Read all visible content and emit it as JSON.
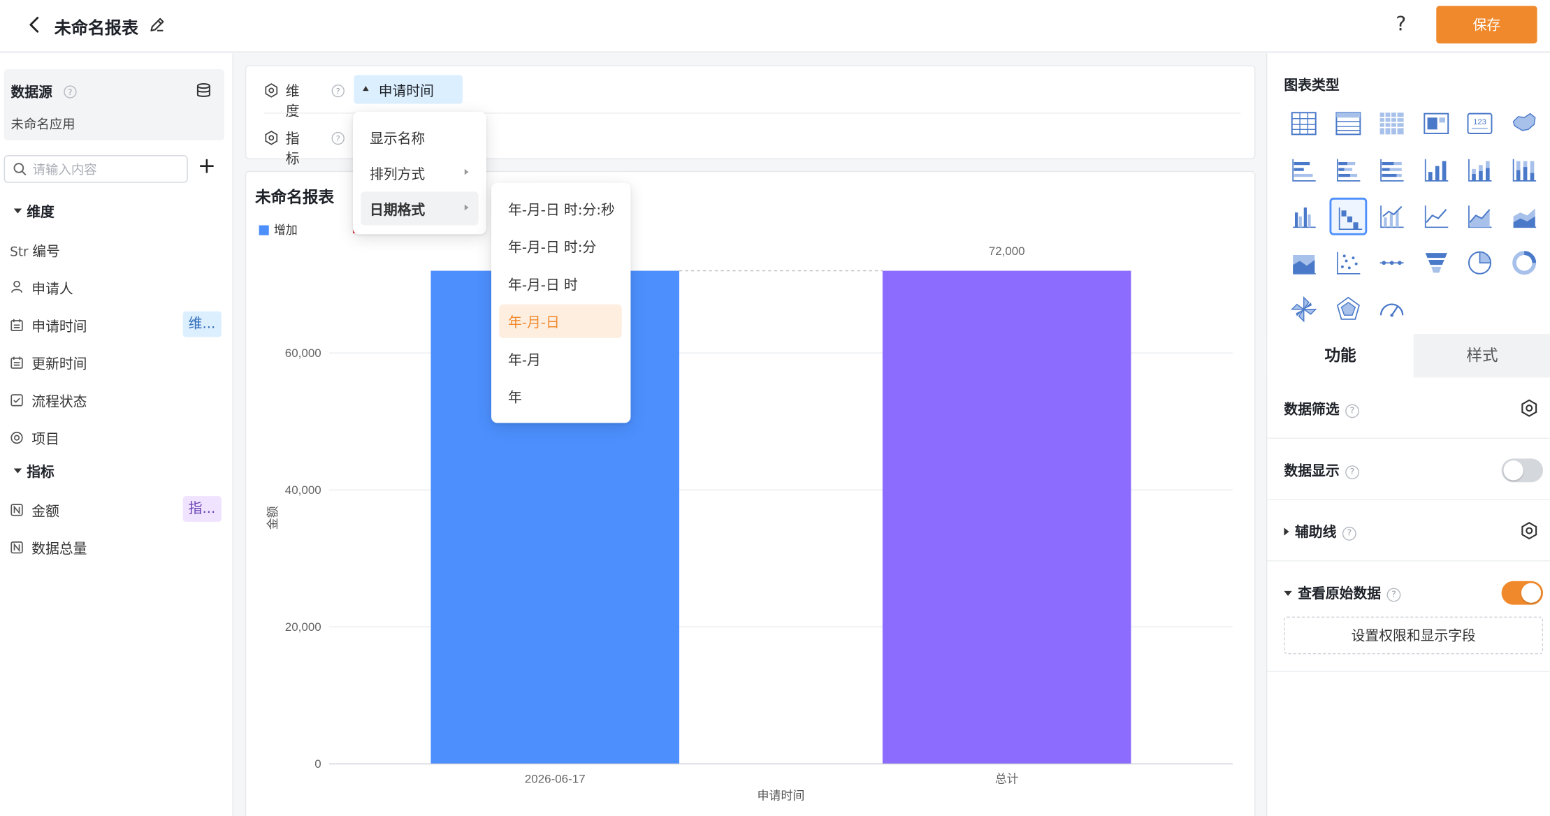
{
  "header": {
    "title": "未命名报表",
    "help": "?",
    "save_label": "保存"
  },
  "datasource": {
    "title": "数据源",
    "app_name": "未命名应用",
    "search_placeholder": "请输入内容",
    "add": "+"
  },
  "dimensions": {
    "label": "维度",
    "items": [
      {
        "icon": "Str",
        "label": "编号"
      },
      {
        "icon": "person-icon",
        "label": "申请人"
      },
      {
        "icon": "calendar-icon",
        "label": "申请时间",
        "tag": "维..."
      },
      {
        "icon": "calendar-icon",
        "label": "更新时间"
      },
      {
        "icon": "checkbox-icon",
        "label": "流程状态"
      },
      {
        "icon": "radio-icon",
        "label": "项目"
      }
    ]
  },
  "indicators": {
    "label": "指标",
    "items": [
      {
        "icon": "number-icon",
        "label": "金额",
        "tag": "指..."
      },
      {
        "icon": "number-icon",
        "label": "数据总量"
      }
    ]
  },
  "config": {
    "dimension_label": "维度",
    "indicator_label": "指标",
    "dimension_chip": "申请时间"
  },
  "dropdown": {
    "items": [
      "显示名称",
      "排列方式",
      "日期格式"
    ],
    "active": "日期格式"
  },
  "date_format_menu": {
    "items": [
      "年-月-日 时:分:秒",
      "年-月-日 时:分",
      "年-月-日 时",
      "年-月-日",
      "年-月",
      "年"
    ],
    "selected": "年-月-日"
  },
  "chart_card": {
    "title": "未命名报表",
    "legend_increase": "增加"
  },
  "chart_data": {
    "type": "bar",
    "subtype": "waterfall",
    "categories": [
      "2026-06-17",
      "总计"
    ],
    "values": [
      72000,
      72000
    ],
    "colors": [
      "#4c8ffd",
      "#8c6bff"
    ],
    "data_labels": [
      "",
      "72,000"
    ],
    "xlabel": "申请时间",
    "ylabel": "金额",
    "ylim": [
      0,
      72000
    ],
    "yticks": [
      0,
      20000,
      40000,
      60000
    ],
    "ytick_labels": [
      "0",
      "20,000",
      "40,000",
      "60,000"
    ],
    "grid": true,
    "legend": "top-left"
  },
  "right_panel": {
    "chart_type_title": "图表类型",
    "chart_types": [
      "table-icon",
      "list-table-icon",
      "pivot-table-icon",
      "card-icon",
      "number-card-icon",
      "map-icon",
      "bar-horizontal-icon",
      "stacked-bar-horizontal-icon",
      "percent-bar-horizontal-icon",
      "column-icon",
      "stacked-column-icon",
      "percent-column-icon",
      "grouped-column-icon",
      "waterfall-icon",
      "column-line-icon",
      "line-icon",
      "area-icon",
      "stacked-area-icon",
      "percent-area-icon",
      "scatter-icon",
      "dot-line-icon",
      "funnel-icon",
      "pie-icon",
      "donut-icon",
      "rose-icon",
      "radar-icon",
      "gauge-icon"
    ],
    "selected_chart_type": "waterfall-icon",
    "tabs": [
      "功能",
      "样式"
    ],
    "rows": {
      "data_filter": "数据筛选",
      "data_display": "数据显示",
      "aux_line": "辅助线",
      "raw_data": "查看原始数据",
      "perm_button": "设置权限和显示字段"
    },
    "help": "?",
    "toggles": {
      "data_display": false,
      "raw_data": true
    },
    "accent_color": "#f0892b"
  }
}
